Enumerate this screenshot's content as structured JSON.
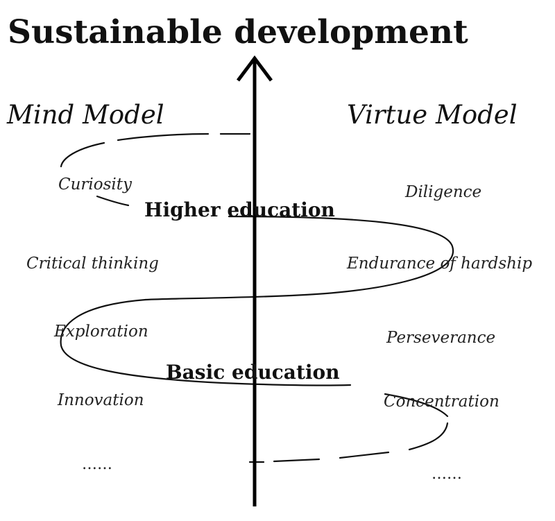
{
  "title": "Sustainable development",
  "left_model": {
    "title": "Mind Model",
    "items": [
      "Curiosity",
      "Critical thinking",
      "Exploration",
      "Innovation"
    ],
    "ellipsis": "……"
  },
  "right_model": {
    "title": "Virtue Model",
    "items": [
      "Diligence",
      "Endurance of hardship",
      "Perseverance",
      "Concentration"
    ],
    "ellipsis": "……"
  },
  "levels": {
    "higher": "Higher education",
    "basic": "Basic education"
  }
}
